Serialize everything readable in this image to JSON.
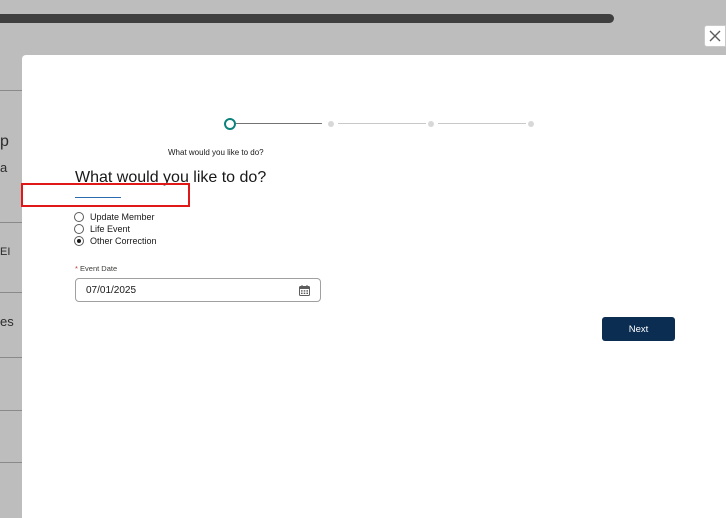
{
  "background": {
    "left_edge_chars": [
      "p",
      "a",
      "EI",
      "es"
    ]
  },
  "modal": {
    "close_icon": "close-icon",
    "progress": {
      "current_step": 1,
      "total_steps": 3
    },
    "step_caption": "What would you like to do?",
    "heading": "What would you like to do?",
    "radio_options": [
      {
        "label": "Update Member",
        "checked": false
      },
      {
        "label": "Life Event",
        "checked": false
      },
      {
        "label": "Other Correction",
        "checked": true
      }
    ],
    "event_date": {
      "required_marker": "*",
      "label": "Event Date",
      "value": "07/01/2025",
      "icon": "calendar-icon"
    },
    "next_label": "Next"
  },
  "colors": {
    "brand_teal": "#0b827c",
    "primary_button": "#0b2d52",
    "highlight_red": "#e01818"
  }
}
